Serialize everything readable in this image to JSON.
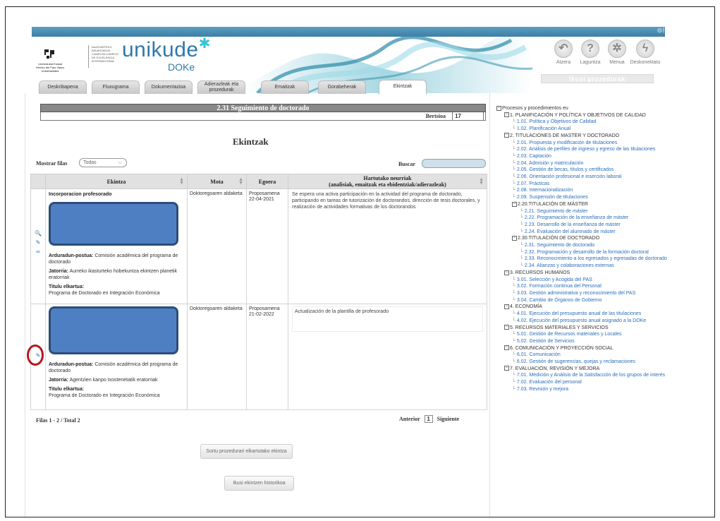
{
  "header": {
    "logo_upv_caption": "Universidad Euskal Herriko del País Vasco Unibertsitatea",
    "campus_caption": "NAZIOARTEKO BIKAINTASUN CAMPUSA CAMPUS DE EXCELENCIA INTERNACIONAL",
    "brand": "unikude",
    "brand_sub": "DOKe",
    "top_icons": "◎|◎"
  },
  "toolbar": {
    "atzera": "Atzera",
    "laguntza": "Laguntza",
    "menua": "Menua",
    "deskonektatu": "Deskonektatu",
    "ikusi_prozedurak": "Ikusi prozedurak"
  },
  "tabs": [
    {
      "label": "Deskribapena"
    },
    {
      "label": "Fluxugrama"
    },
    {
      "label": "Dokumentazioa"
    },
    {
      "label": "Adierazleak eta prozedurak"
    },
    {
      "label": "Emaitzak"
    },
    {
      "label": "Gorabeherak"
    },
    {
      "label": "Ekintzak"
    }
  ],
  "page": {
    "title": "2.31 Seguimiento de doctorado",
    "version_label": "Bertsioa",
    "version_value": "17",
    "heading": "Ekintzak",
    "mostrar_label": "Mostrar filas",
    "mostrar_value": "Todas",
    "buscar_label": "Buscar",
    "buscar_value": ""
  },
  "table": {
    "headers": {
      "ekintza": "Ekintza",
      "mota": "Mota",
      "egoera": "Egoera",
      "neurriak_1": "Hartutako neurriak",
      "neurriak_2": "(analisiak, emaitzak eta ebidentziak/adierazleak)"
    },
    "rows": [
      {
        "title": "Incorporacion profesorado",
        "arduradun_k": "Arduradun-postua:",
        "arduradun_v": "Comisión académica del programa de doctorado",
        "jatorria_k": "Jatorria:",
        "jatorria_v": "Aurreko ikasturteko hobekuntza ekintzen planetik eratorriak",
        "titulu_k": "Titulu elkartua:",
        "titulu_v": "Programa de Doctorado en Integración Económica",
        "mota": "Doktoregoaren aldaketa",
        "egoera": "Proposamena 22-04-2021",
        "neurriak": "Se espera una activa participación en la actividad del programa de doctorado, participando en tareas de tutorización de doctorandos, dirección de tesis doctorales, y realización de actividades formativas de los doctorandos"
      },
      {
        "title": "",
        "arduradun_k": "Arduradun-postua:",
        "arduradun_v": "Comisión académica del programa de doctorado",
        "jatorria_k": "Jatorria:",
        "jatorria_v": "Agentzien kanpo txostenetatik eratorriak",
        "titulu_k": "Titulu elkartua:",
        "titulu_v": "Programa de Doctorado en Integración Económica",
        "mota": "Doktoregoaren aldaketa",
        "egoera": "Proposamena 21-02-2022",
        "neurriak": "Actualización de la plantilla de profesorado"
      }
    ]
  },
  "footer": {
    "filas": "Filas 1 - 2 / Total 2",
    "anterior": "Anterior",
    "page": "1",
    "siguiente": "Siguiente",
    "sortu_btn": "Sortu prozedurari elkartutako ekintza",
    "historikoa_btn": "Ikusi ekintzen historikoa"
  },
  "tree": [
    {
      "level": 0,
      "box": "-",
      "text": "Procesos y procedimientos eu",
      "link": false
    },
    {
      "level": 1,
      "box": "-",
      "text": "1. PLANIFICACIÓN Y POLÍTICA Y OBJETIVOS DE CALIDAD",
      "link": false
    },
    {
      "level": 2,
      "box": "",
      "text": "1.01. Política y Objetivos de Calidad",
      "link": true
    },
    {
      "level": 2,
      "box": "",
      "text": "1.02. Planificación Anual",
      "link": true
    },
    {
      "level": 1,
      "box": "-",
      "text": "2. TITULACIONES DE MASTER Y DOCTORADO",
      "link": false
    },
    {
      "level": 2,
      "box": "",
      "text": "2.01. Propuesta y modificación de titulaciones",
      "link": true
    },
    {
      "level": 2,
      "box": "",
      "text": "2.02. Análisis de perfiles de ingreso y egreso de las titulaciones",
      "link": true
    },
    {
      "level": 2,
      "box": "",
      "text": "2.03. Captación",
      "link": true
    },
    {
      "level": 2,
      "box": "",
      "text": "2.04. Admisión y matriculación",
      "link": true
    },
    {
      "level": 2,
      "box": "",
      "text": "2.05. Gestión de becas, títulos y certificados",
      "link": true
    },
    {
      "level": 2,
      "box": "",
      "text": "2.06. Orientación profesional e inserción laboral",
      "link": true
    },
    {
      "level": 2,
      "box": "",
      "text": "2.07. Prácticas",
      "link": true
    },
    {
      "level": 2,
      "box": "",
      "text": "2.08. Internacionalización",
      "link": true
    },
    {
      "level": 2,
      "box": "",
      "text": "2.09. Suspensión de titulaciones",
      "link": true
    },
    {
      "level": 2,
      "box": "-",
      "text": "2.20.TITULACIÓN DE MÁSTER",
      "link": false
    },
    {
      "level": 3,
      "box": "",
      "text": "2.21. Seguimiento de máster",
      "link": true
    },
    {
      "level": 3,
      "box": "",
      "text": "2.22. Programación de la enseñanza de máster",
      "link": true
    },
    {
      "level": 3,
      "box": "",
      "text": "2.23. Desarrollo de la enseñanza de máster",
      "link": true
    },
    {
      "level": 3,
      "box": "",
      "text": "2.24. Evaluación del alumnado de máster",
      "link": true
    },
    {
      "level": 2,
      "box": "-",
      "text": "2.30.TITULACIÓN DE DOCTORADO",
      "link": false
    },
    {
      "level": 3,
      "box": "",
      "text": "2.31. Seguimiento de doctorado",
      "link": true
    },
    {
      "level": 3,
      "box": "",
      "text": "2.32. Programación y desarrollo de la formación doctoral",
      "link": true
    },
    {
      "level": 3,
      "box": "",
      "text": "2.33. Reconocimiento a los egresados y egresadas de doctorado",
      "link": true
    },
    {
      "level": 3,
      "box": "",
      "text": "2.34. Alianzas y colaboraciones externas",
      "link": true
    },
    {
      "level": 1,
      "box": "-",
      "text": "3. RECURSOS HUMANOS",
      "link": false
    },
    {
      "level": 2,
      "box": "",
      "text": "3.01. Selección y Acogida del PAS",
      "link": true
    },
    {
      "level": 2,
      "box": "",
      "text": "3.02. Formación continua del Personal",
      "link": true
    },
    {
      "level": 2,
      "box": "",
      "text": "3.03. Gestión administrativa y reconocimiento del PAS",
      "link": true
    },
    {
      "level": 2,
      "box": "",
      "text": "3.04. Cambio de Órganos de Gobierno",
      "link": true
    },
    {
      "level": 1,
      "box": "-",
      "text": "4. ECONOMÍA",
      "link": false
    },
    {
      "level": 2,
      "box": "",
      "text": "4.01. Ejecución del presupuesto anual de las titulaciones",
      "link": true
    },
    {
      "level": 2,
      "box": "",
      "text": "4.02. Ejecución del presupuesto anual asignado a la DOKe",
      "link": true
    },
    {
      "level": 1,
      "box": "-",
      "text": "5. RECURSOS MATERIALES Y SERVICIOS",
      "link": false
    },
    {
      "level": 2,
      "box": "",
      "text": "5.01. Gestión de Recursos materiales y Locales",
      "link": true
    },
    {
      "level": 2,
      "box": "",
      "text": "5.02. Gestión de Servicios",
      "link": true
    },
    {
      "level": 1,
      "box": "-",
      "text": "6. COMUNICACIÓN Y PROYECCIÓN SOCIAL",
      "link": false
    },
    {
      "level": 2,
      "box": "",
      "text": "6.01. Comunicación",
      "link": true
    },
    {
      "level": 2,
      "box": "",
      "text": "6.02. Gestión de sugerencias, quejas y reclamaciones",
      "link": true
    },
    {
      "level": 1,
      "box": "-",
      "text": "7. EVALUACIÓN, REVISIÓN Y MEJORA",
      "link": false
    },
    {
      "level": 2,
      "box": "",
      "text": "7.01. Medición y Análisis de la Satisfacción de los grupos de interés",
      "link": true
    },
    {
      "level": 2,
      "box": "",
      "text": "7.02. Evaluación del personal",
      "link": true
    },
    {
      "level": 2,
      "box": "",
      "text": "7.03. Revisión y mejora",
      "link": true
    }
  ]
}
